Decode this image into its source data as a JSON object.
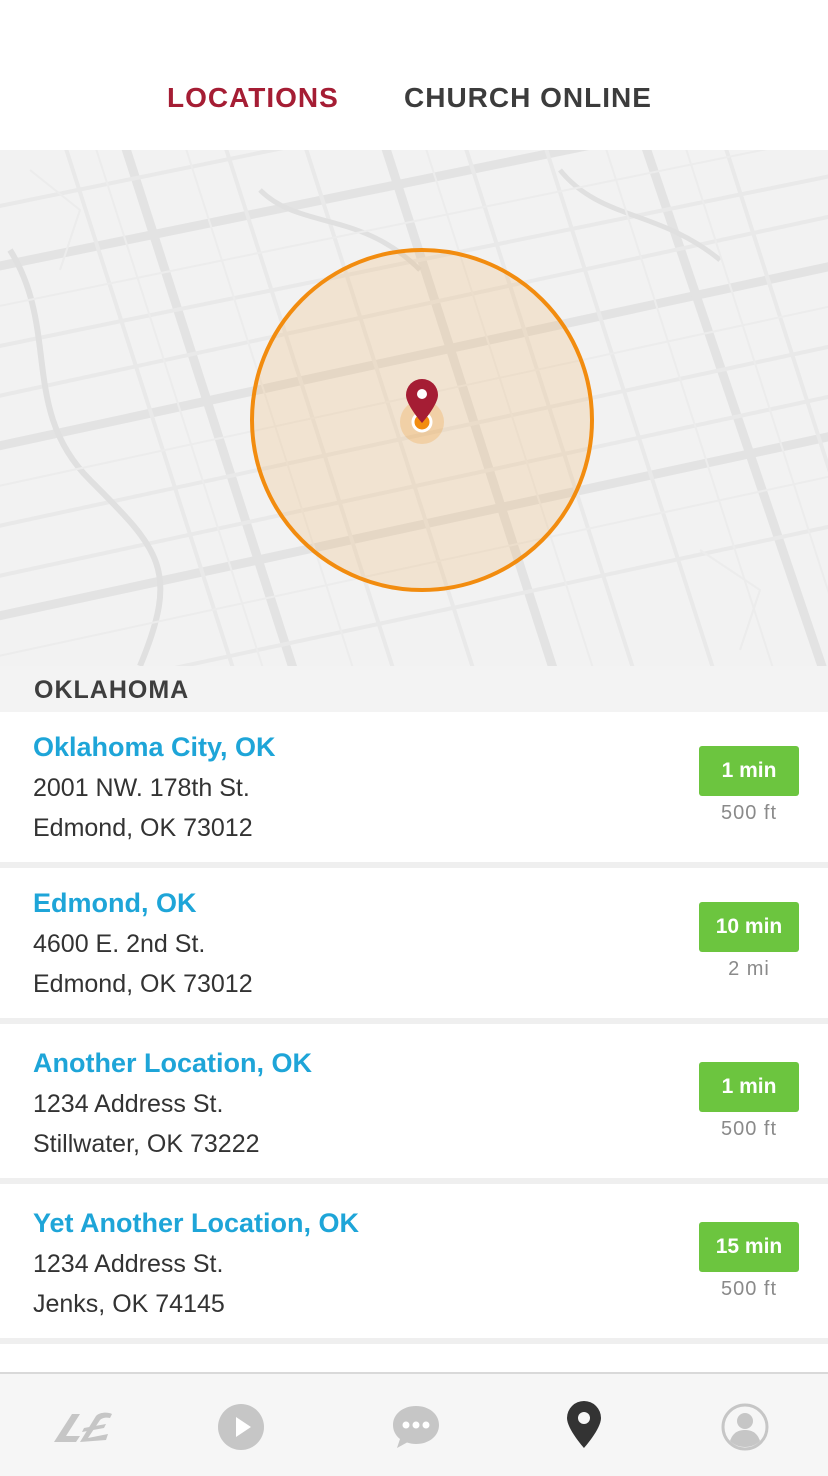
{
  "tabs": [
    {
      "label": "LOCATIONS",
      "active": true
    },
    {
      "label": "CHURCH ONLINE",
      "active": false
    }
  ],
  "map": {
    "pin_icon": "map-pin-icon",
    "accent_color": "#f28c0f",
    "pin_color": "#a51d34"
  },
  "section": {
    "title": "OKLAHOMA"
  },
  "locations": [
    {
      "name": "Oklahoma City, OK",
      "address1": "2001 NW. 178th St.",
      "address2": "Edmond, OK 73012",
      "time": "1 min",
      "distance": "500 ft"
    },
    {
      "name": "Edmond, OK",
      "address1": "4600 E. 2nd St.",
      "address2": "Edmond, OK 73012",
      "time": "10 min",
      "distance": "2 mi"
    },
    {
      "name": "Another Location, OK",
      "address1": "1234 Address St.",
      "address2": "Stillwater, OK 73222",
      "time": "1 min",
      "distance": "500 ft"
    },
    {
      "name": "Yet Another Location, OK",
      "address1": "1234 Address St.",
      "address2": "Jenks, OK 74145",
      "time": "15 min",
      "distance": "500 ft"
    }
  ],
  "navbar": {
    "items": [
      {
        "icon": "brand-logo-icon",
        "active": false
      },
      {
        "icon": "play-icon",
        "active": false
      },
      {
        "icon": "chat-icon",
        "active": false
      },
      {
        "icon": "map-pin-icon",
        "active": true
      },
      {
        "icon": "profile-icon",
        "active": false
      }
    ]
  },
  "colors": {
    "active_tab": "#a51d34",
    "location_name": "#1ea5d8",
    "badge": "#6cc53f"
  }
}
